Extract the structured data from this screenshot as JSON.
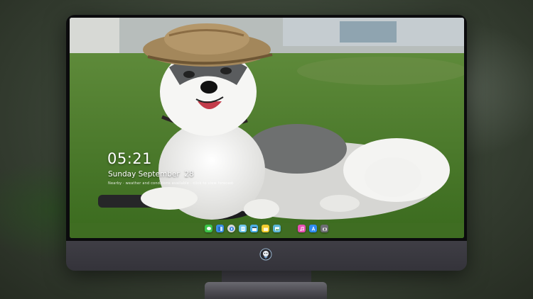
{
  "lockscreen": {
    "time": "05:21",
    "date": "Sunday September  28",
    "weather_line": "Nearby · weather and conditions available · click to view forecast"
  },
  "dock": {
    "icons": [
      {
        "name": "messages-icon",
        "color": "#3cc54a"
      },
      {
        "name": "finder-icon",
        "color": "#3a8ee6"
      },
      {
        "name": "safari-icon",
        "color": "#d7d7d7"
      },
      {
        "name": "files-icon",
        "color": "#6fc5e8"
      },
      {
        "name": "clapper-icon",
        "color": "#4db0e8"
      },
      {
        "name": "notes-icon",
        "color": "#f2cc2e"
      },
      {
        "name": "photos-icon",
        "color": "#5ab6d6"
      },
      {
        "name": "music-icon",
        "color": "#e84fb3"
      },
      {
        "name": "appstore-icon",
        "color": "#2e8cf0"
      },
      {
        "name": "camera-icon",
        "color": "#6e6e74"
      }
    ]
  }
}
